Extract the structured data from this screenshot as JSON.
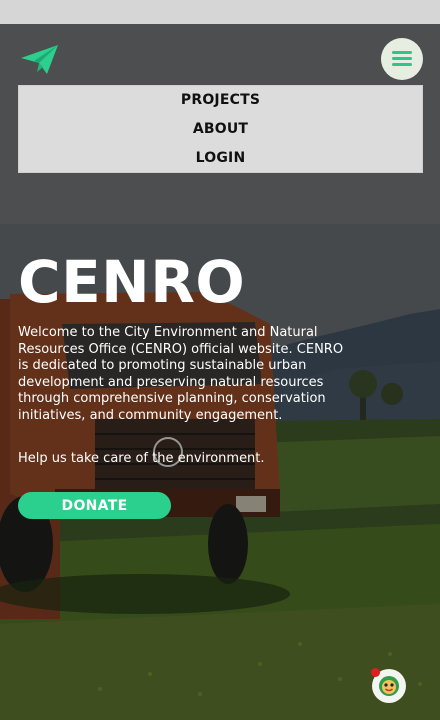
{
  "header": {
    "logo_icon": "paper-plane-icon",
    "menu_icon": "hamburger-menu-icon"
  },
  "nav": {
    "items": [
      {
        "label": "PROJECTS"
      },
      {
        "label": "ABOUT"
      },
      {
        "label": "LOGIN"
      }
    ]
  },
  "hero": {
    "title": "CENRO",
    "description": "Welcome to the City Environment and Natural Resources Office (CENRO) official website. CENRO is dedicated to promoting sustainable urban development and preserving natural resources through comprehensive planning, conservation initiatives, and community engagement.",
    "cta_text": "Help us take care of the environment.",
    "donate_label": "DONATE"
  },
  "chat_widget": {
    "icon": "mascot-chat-icon",
    "has_notification": true
  },
  "colors": {
    "accent": "#2bcf8e",
    "menu_bg": "#dcdcdc",
    "title_color": "#ffffff",
    "notification": "#e02020"
  }
}
